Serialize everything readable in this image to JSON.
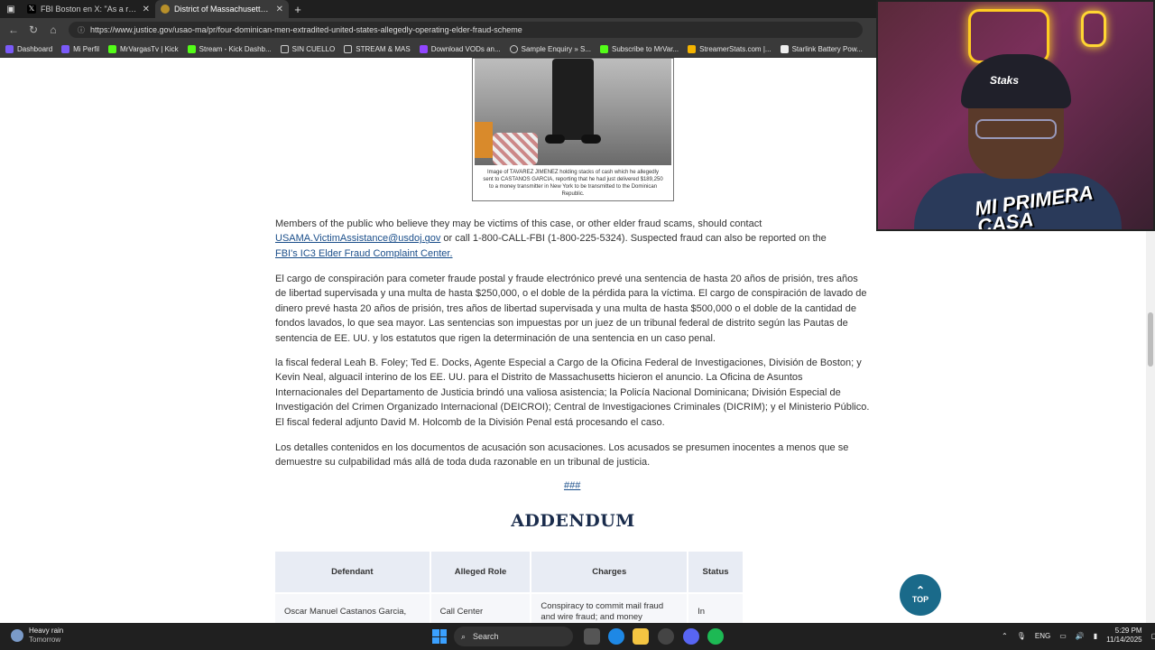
{
  "browser": {
    "tabs": [
      {
        "title": "FBI Boston en X: \"As a result of an",
        "icon": "x-logo-icon",
        "active": false
      },
      {
        "title": "District of Massachusetts | Four Dominican Men",
        "icon": "doj-seal-icon",
        "active": true
      }
    ],
    "url": "https://www.justice.gov/usao-ma/pr/four-dominican-men-extradited-united-states-allegedly-operating-elder-fraud-scheme",
    "bookmarks": [
      "Dashboard",
      "Mi Perfil",
      "MrVargasTv | Kick",
      "Stream - Kick Dashb...",
      "SIN CUELLO",
      "STREAM & MAS",
      "Download VODs an...",
      "Sample Enquiry » S...",
      "Subscribe to MrVar...",
      "StreamerStats.com |...",
      "Starlink Battery Pow..."
    ]
  },
  "image_caption": "Image of TAVAREZ JIMENEZ holding stacks of cash which he allegedly sent to CASTANOS GARCIA, reporting that he had just delivered $189,250 to a money transmitter in New York to be transmitted to the Dominican Republic.",
  "contact": {
    "text1": "Members of the public who believe they may be victims of this case, or other elder fraud scams, should contact",
    "email_link": "USAMA.VictimAssistance@usdoj.gov",
    "text2": " or call 1-800-CALL-FBI (1-800-225-5324). Suspected fraud can also be reported on the",
    "ic3_link": "FBI's IC3 Elder Fraud Complaint Center."
  },
  "para_sentencing": "El cargo de conspiración para cometer fraude postal y fraude electrónico prevé una sentencia de hasta 20 años de prisión, tres años de libertad supervisada y una multa de hasta $250,000, o el doble de la pérdida para la víctima. El cargo de conspiración de lavado de dinero prevé hasta 20 años de prisión, tres años de libertad supervisada y una multa de hasta $500,000 o el doble de la cantidad de fondos lavados, lo que sea mayor. Las sentencias son impuestas por un juez de un tribunal federal de distrito según las Pautas de sentencia de EE. UU. y los estatutos que rigen la determinación de una sentencia en un caso penal.",
  "para_announcement": "la fiscal federal Leah B. Foley; Ted E. Docks, Agente Especial a Cargo de la Oficina Federal de Investigaciones, División de Boston; y Kevin Neal, alguacil interino de los EE. UU. para el Distrito de Massachusetts hicieron el anuncio. La Oficina de Asuntos Internacionales del Departamento de Justicia brindó una valiosa asistencia; la Policía Nacional Dominicana; División Especial de Investigación del Crimen Organizado Internacional (DEICROI); Central de Investigaciones Criminales (DICRIM); y el Ministerio Público. El fiscal federal adjunto David M. Holcomb de la División Penal está procesando el caso.",
  "para_disclaimer": "Los detalles contenidos en los documentos de acusación son acusaciones. Los acusados se presumen inocentes a menos que se demuestre su culpabilidad más allá de toda duda razonable en un tribunal de justicia.",
  "hash_link": "###",
  "addendum_title": "ADDENDUM",
  "table": {
    "headers": [
      "Defendant",
      "Alleged Role",
      "Charges",
      "Status"
    ],
    "rows": [
      [
        "Oscar Manuel Castanos Garcia,",
        "Call Center",
        "Conspiracy to commit mail fraud and wire fraud; and money",
        "In"
      ]
    ]
  },
  "top_button": "TOP",
  "webcam": {
    "cap_text": "Staks",
    "overlay_logo": "MI PRIMERA CASA"
  },
  "taskbar": {
    "weather_title": "Heavy rain",
    "weather_sub": "Tomorrow",
    "search_label": "Search",
    "lang": "ENG",
    "time": "5:29 PM",
    "date": "11/14/2025"
  }
}
